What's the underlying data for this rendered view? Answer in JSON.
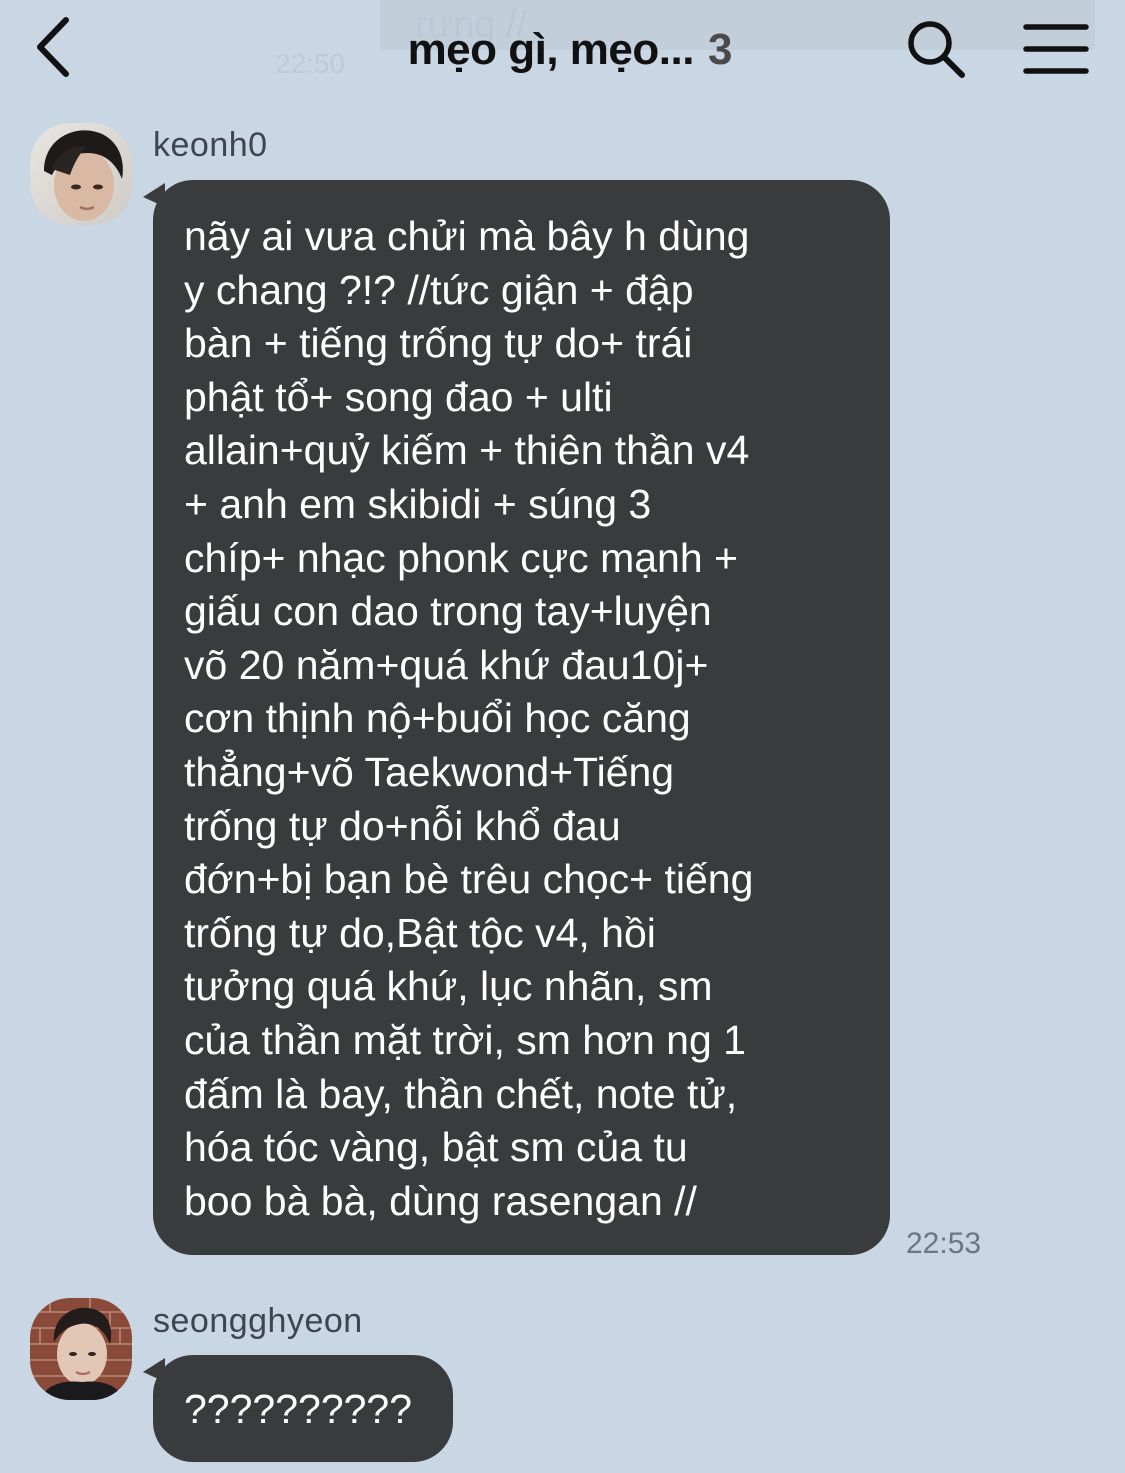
{
  "header": {
    "title": "mẹo gì, mẹo...",
    "member_count": "3",
    "ghost_message": "rưng //",
    "ghost_time": "22:50"
  },
  "messages": [
    {
      "sender": "keonh0",
      "text": "nãy ai vưa chửi mà bây h dùng\ny chang ?!? //tức giận + đập\nbàn + tiếng trống tự do+ trái\nphật tổ+ song đao + ulti\nallain+quỷ kiếm + thiên thần v4\n+ anh em skibidi + súng 3\nchíp+ nhạc phonk cực mạnh +\ngiấu con dao trong tay+luyện\nvõ 20 năm+quá khứ đau10j+\ncơn thịnh nộ+buổi học căng\nthẳng+võ Taekwond+Tiếng\ntrống tự do+nỗi khổ đau\nđớn+bị bạn bè trêu chọc+ tiếng\ntrống tự do,Bật tộc v4, hồi\ntưởng quá khứ, lục nhãn, sm\ncủa thần mặt trời, sm hơn ng 1\nđấm là bay, thần chết, note tử,\nhóa tóc vàng, bật sm của tu\nboo bà bà, dùng rasengan //",
      "time": "22:53"
    },
    {
      "sender": "seongghyeon",
      "text": "??????????"
    }
  ],
  "colors": {
    "background": "#c9d6e3",
    "bubble": "#3a3b3d",
    "bubble_text": "#ffffff"
  },
  "icons": {
    "back": "chevron-left-icon",
    "search": "search-icon",
    "menu": "hamburger-menu-icon"
  }
}
